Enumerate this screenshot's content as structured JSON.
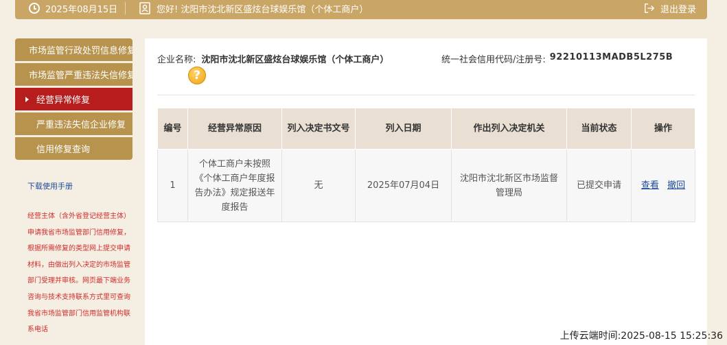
{
  "topbar": {
    "date": "2025年08月15日",
    "greeting": "您好! 沈阳市沈北新区盛炫台球娱乐馆（个体工商户）",
    "logout": "退出登录"
  },
  "sidebar": {
    "items": [
      {
        "label": "市场监管行政处罚信息修复"
      },
      {
        "label": "市场监管严重违法失信修复"
      },
      {
        "label": "经营异常修复"
      },
      {
        "label": "严重违法失信企业修复"
      },
      {
        "label": "信用修复查询"
      }
    ],
    "manual_link": "下载使用手册",
    "notice": "经营主体（含外省登记经营主体）申请我省市场监管部门信用修复，根据所需修复的类型网上提交申请材料，由做出列入决定的市场监管部门受理并审核。网页最下端业务咨询与技术支持联系方式里可查询我省市场监管部门信用监管机构联系电话"
  },
  "company": {
    "name_label": "企业名称:",
    "name": "沈阳市沈北新区盛炫台球娱乐馆（个体工商户）",
    "credit_label": "统一社会信用代码/注册号:",
    "credit_code": "92210113MADB5L275B"
  },
  "table": {
    "headers": [
      "编号",
      "经营异常原因",
      "列入决定书文号",
      "列入日期",
      "作出列入决定机关",
      "当前状态",
      "操作"
    ],
    "rows": [
      {
        "no": "1",
        "reason": "个体工商户未按照《个体工商户年度报告办法》规定报送年度报告",
        "doc_no": "无",
        "date": "2025年07月04日",
        "authority": "沈阳市沈北新区市场监督管理局",
        "status": "已提交申请",
        "action_view": "查看",
        "action_withdraw": "撤回"
      }
    ]
  },
  "footer": {
    "upload_time": "上传云端时间:2025-08-15 15:25:36"
  }
}
